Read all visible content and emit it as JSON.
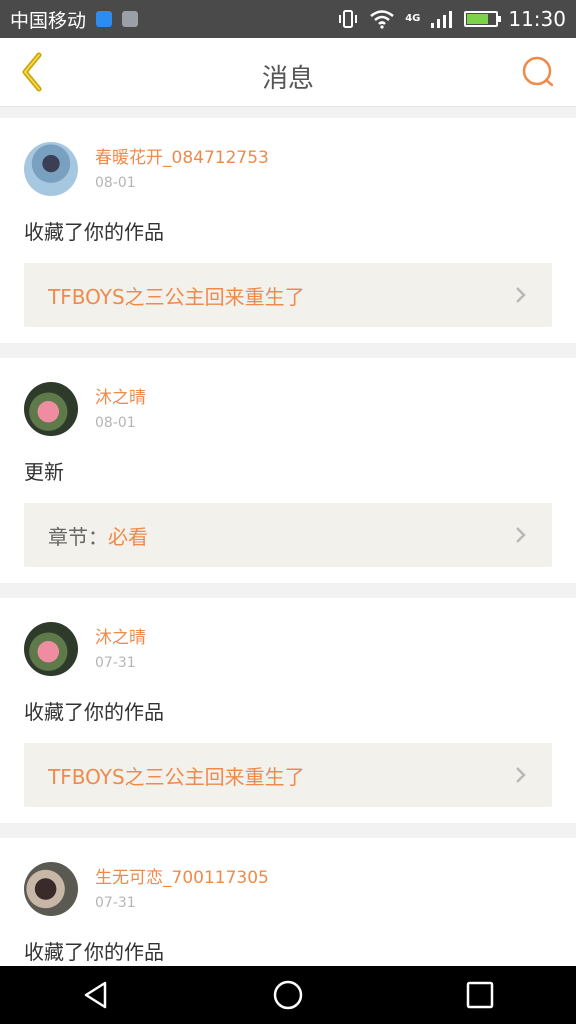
{
  "status_bar": {
    "carrier": "中国移动",
    "time": "11:30",
    "network": "4G",
    "battery_level": 0.7,
    "icons": [
      "app-icon-blue",
      "app-icon-image",
      "vibrate-icon",
      "wifi-icon",
      "signal-icon",
      "battery-icon"
    ]
  },
  "header": {
    "title": "消息",
    "back_icon": "chevron-left-icon",
    "search_icon": "search-icon"
  },
  "colors": {
    "accent": "#f08a4b",
    "back_arrow": "#c9a400",
    "link_bg": "#f3f1eb"
  },
  "messages": [
    {
      "username": "春暖花开_084712753",
      "date": "08-01",
      "action": "收藏了你的作品",
      "link_text": "TFBOYS之三公主回来重生了"
    },
    {
      "username": "沐之晴",
      "date": "08-01",
      "action": "更新",
      "chapter_label": "章节：",
      "chapter_value": "必看"
    },
    {
      "username": "沐之晴",
      "date": "07-31",
      "action": "收藏了你的作品",
      "link_text": "TFBOYS之三公主回来重生了"
    },
    {
      "username": "生无可恋_700117305",
      "date": "07-31",
      "action": "收藏了你的作品"
    }
  ]
}
